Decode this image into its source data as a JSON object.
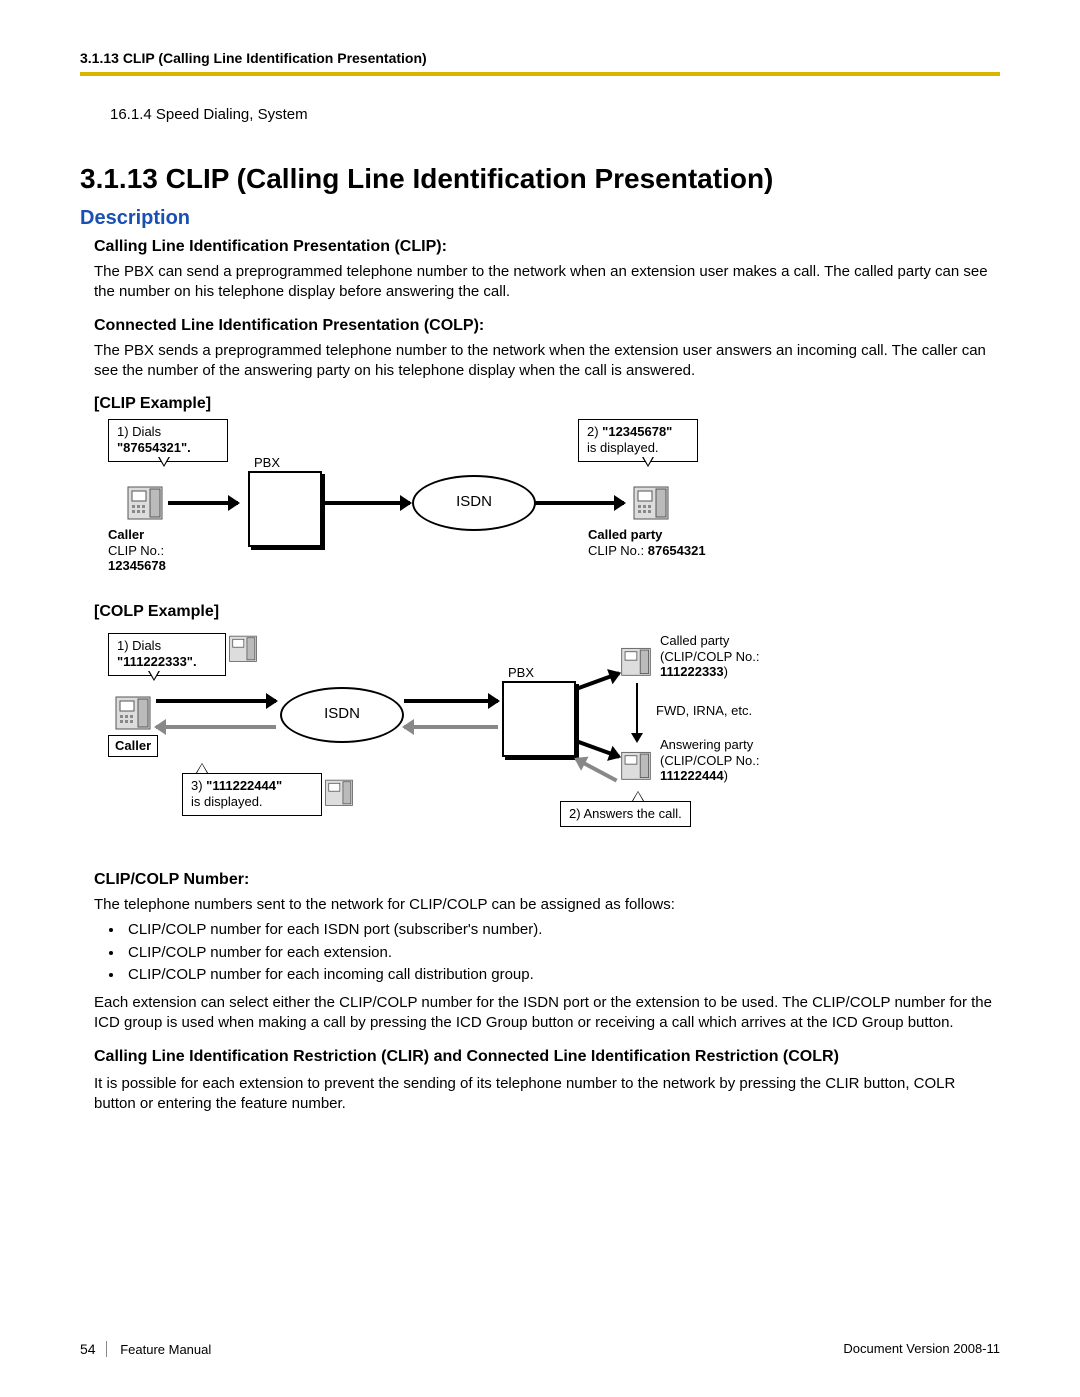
{
  "header": {
    "running": "3.1.13 CLIP (Calling Line Identification Presentation)",
    "pre_section": "16.1.4  Speed Dialing, System"
  },
  "title": "3.1.13  CLIP (Calling Line Identification Presentation)",
  "description_label": "Description",
  "clip": {
    "heading": "Calling Line Identification Presentation (CLIP):",
    "text": "The PBX can send a preprogrammed telephone number to the network when an extension user makes a call. The called party can see the number on his telephone display before answering the call."
  },
  "colp": {
    "heading": "Connected Line Identification Presentation (COLP):",
    "text": "The PBX sends a preprogrammed telephone number to the network when the extension user answers an incoming call. The caller can see the number of the answering party on his telephone display when the call is answered."
  },
  "clip_example": {
    "heading": "[CLIP Example]",
    "dial_prefix": "1) Dials",
    "dial_number": "\"87654321\".",
    "pbx_label": "PBX",
    "isdn_label": "ISDN",
    "disp_prefix": "2) ",
    "disp_number": "\"12345678\"",
    "disp_suffix": "is displayed.",
    "caller_label": "Caller",
    "caller_clip_prefix": "CLIP No.: ",
    "caller_clip_no": "12345678",
    "called_label": "Called party",
    "called_clip_prefix": "CLIP No.: ",
    "called_clip_no": "87654321"
  },
  "colp_example": {
    "heading": "[COLP Example]",
    "dial_prefix": "1) Dials",
    "dial_number": "\"111222333\".",
    "isdn_label": "ISDN",
    "pbx_label": "PBX",
    "disp_prefix": "3) ",
    "disp_number": "\"111222444\"",
    "disp_suffix": "is displayed.",
    "caller_label": "Caller",
    "called_party_line1": "Called party",
    "called_party_line2": "(CLIP/COLP No.:",
    "called_party_no": "111222333",
    "close_paren": ")",
    "fwd_line": "FWD, IRNA, etc.",
    "answering_line1": "Answering party",
    "answering_line2": "(CLIP/COLP No.:",
    "answering_no": "111222444",
    "answers_call": "2) Answers the call."
  },
  "clip_colp_number": {
    "heading": "CLIP/COLP Number:",
    "intro": "The telephone numbers sent to the network for CLIP/COLP can be assigned as follows:",
    "bullets": [
      "CLIP/COLP number for each ISDN port (subscriber's number).",
      "CLIP/COLP number for each extension.",
      "CLIP/COLP number for each incoming call distribution group."
    ],
    "after": "Each extension can select either the CLIP/COLP number for the ISDN port or the extension to be used. The CLIP/COLP number for the ICD group is used when making a call by pressing the ICD Group button or receiving a call which arrives at the ICD Group button."
  },
  "clir_colr": {
    "heading": "Calling Line Identification Restriction (CLIR) and Connected Line Identification Restriction (COLR)",
    "text": "It is possible for each extension to prevent the sending of its telephone number to the network by pressing the CLIR button, COLR button or entering the feature number."
  },
  "footer": {
    "page": "54",
    "manual": "Feature Manual",
    "version_label": "Document Version  ",
    "version": "2008-11"
  }
}
